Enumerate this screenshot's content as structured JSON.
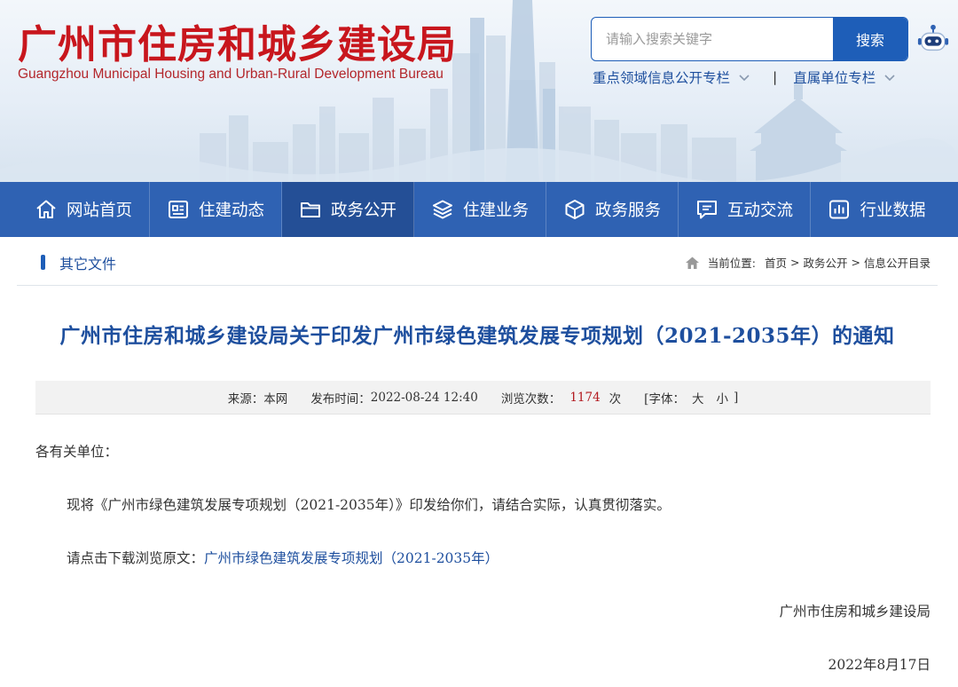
{
  "header": {
    "title": "广州市住房和城乡建设局",
    "subtitle": "Guangzhou Municipal Housing and Urban-Rural Development Bureau",
    "search": {
      "placeholder": "请输入搜索关键字",
      "button": "搜索"
    },
    "quick_links": [
      {
        "label": "重点领域信息公开专栏"
      },
      {
        "label": "直属单位专栏"
      }
    ],
    "separator": "|"
  },
  "nav": {
    "items": [
      {
        "label": "网站首页",
        "icon": "home-icon"
      },
      {
        "label": "住建动态",
        "icon": "news-icon"
      },
      {
        "label": "政务公开",
        "icon": "folder-icon",
        "active": true
      },
      {
        "label": "住建业务",
        "icon": "layers-icon"
      },
      {
        "label": "政务服务",
        "icon": "cube-icon"
      },
      {
        "label": "互动交流",
        "icon": "chat-icon"
      },
      {
        "label": "行业数据",
        "icon": "bar-chart-icon"
      }
    ]
  },
  "section": {
    "title": "其它文件"
  },
  "breadcrumb": {
    "prefix": "当前位置:",
    "items": [
      "首页",
      "政务公开",
      "信息公开目录"
    ],
    "separator": ">"
  },
  "article": {
    "title": "广州市住房和城乡建设局关于印发广州市绿色建筑发展专项规划（2021-2035年）的通知",
    "meta": {
      "source_label": "来源：",
      "source": "本网",
      "published_label": "发布时间：",
      "published": "2022-08-24 12:40",
      "views_label": "浏览次数：",
      "views": "1174",
      "views_unit": "次",
      "font_label": "[字体：",
      "font_large": "大",
      "font_small": "小",
      "font_close": "]"
    },
    "greeting": "各有关单位：",
    "para1": "现将《广州市绿色建筑发展专项规划（2021-2035年）》印发给你们，请结合实际，认真贯彻落实。",
    "para2_prefix": "请点击下载浏览原文：",
    "download_link": "广州市绿色建筑发展专项规划（2021-2035年）",
    "signature": "广州市住房和城乡建设局",
    "date": "2022年8月17日"
  },
  "colors": {
    "brand_red": "#c8161d",
    "nav_blue": "#2f62b3",
    "nav_active": "#244f96",
    "link_blue": "#1e4f9e",
    "count_red": "#b3191f"
  }
}
